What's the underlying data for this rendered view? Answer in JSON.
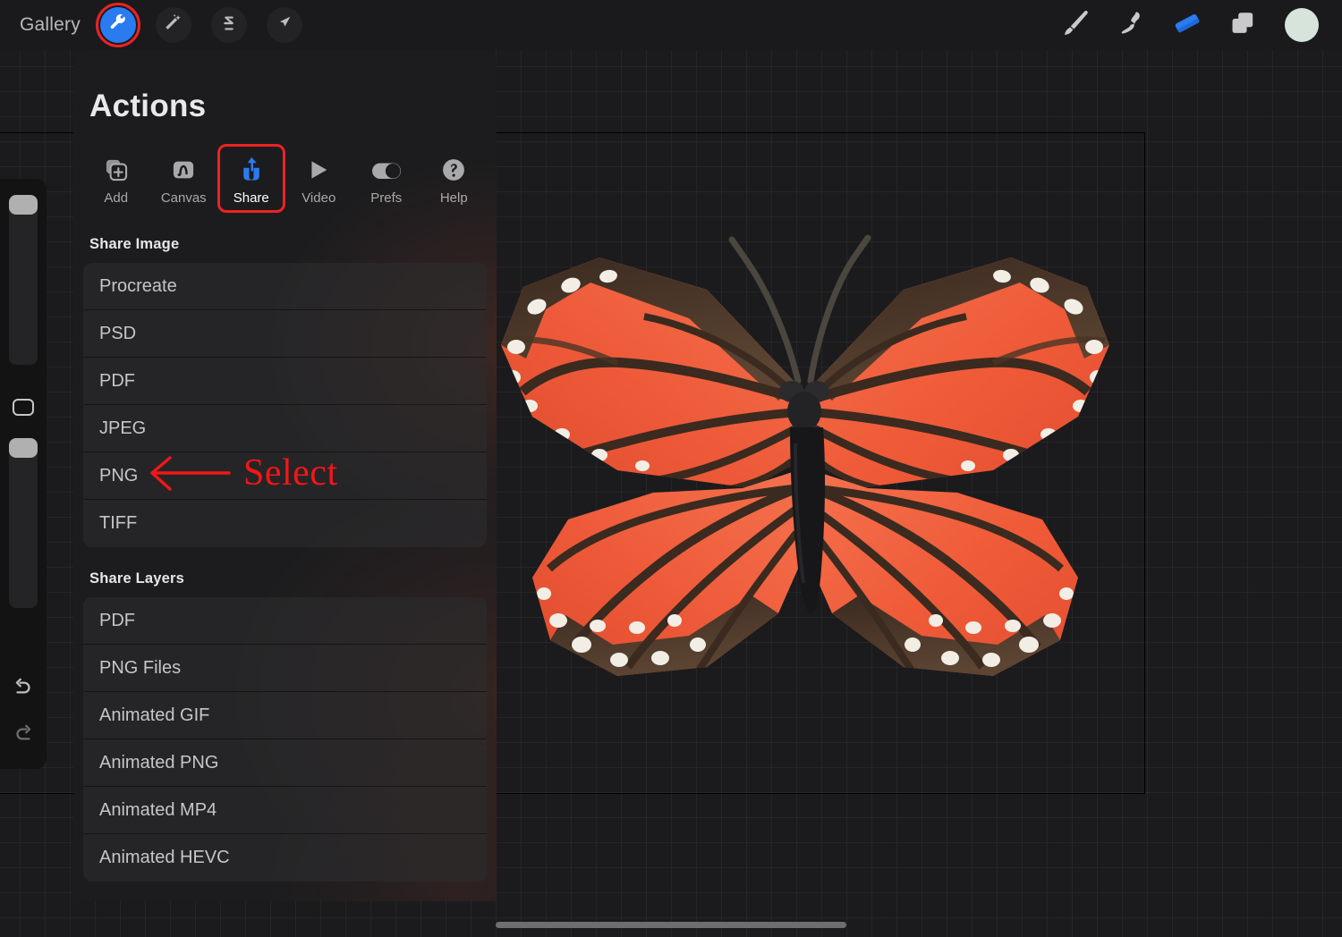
{
  "app": {
    "name": "Procreate",
    "accent_blue": "#2a7bf0",
    "highlight_red": "#ee2222",
    "annotation_red": "#f41616"
  },
  "topbar": {
    "gallery_label": "Gallery",
    "left_tools": [
      {
        "name": "actions-wrench",
        "icon": "wrench-icon",
        "active": true,
        "highlighted": true
      },
      {
        "name": "adjustments",
        "icon": "magic-wand-icon",
        "active": false,
        "highlighted": false
      },
      {
        "name": "selection",
        "icon": "s-curve-icon",
        "active": false,
        "highlighted": false
      },
      {
        "name": "transform",
        "icon": "arrow-diagonal-icon",
        "active": false,
        "highlighted": false
      }
    ],
    "right_tools": [
      {
        "name": "paint",
        "icon": "paintbrush-icon",
        "active": false
      },
      {
        "name": "smudge",
        "icon": "smudge-finger-icon",
        "active": false
      },
      {
        "name": "erase",
        "icon": "eraser-icon",
        "active": true
      },
      {
        "name": "layers",
        "icon": "layers-icon",
        "active": false
      }
    ],
    "color_swatch": "#d6e4dc"
  },
  "sidebar": {
    "brush_size_value": "100%",
    "brush_opacity_value": "100%",
    "modify_icon": "square-modify-icon",
    "undo_icon": "undo-arrow-icon",
    "redo_icon": "redo-arrow-icon"
  },
  "panel": {
    "title": "Actions",
    "tabs": [
      {
        "label": "Add",
        "icon": "add-stack-icon",
        "selected": false
      },
      {
        "label": "Canvas",
        "icon": "canvas-wave-icon",
        "selected": false
      },
      {
        "label": "Share",
        "icon": "share-arrow-icon",
        "selected": true
      },
      {
        "label": "Video",
        "icon": "play-icon",
        "selected": false
      },
      {
        "label": "Prefs",
        "icon": "toggle-icon",
        "selected": false
      },
      {
        "label": "Help",
        "icon": "question-icon",
        "selected": false
      }
    ],
    "share_image": {
      "heading": "Share Image",
      "items": [
        {
          "label": "Procreate"
        },
        {
          "label": "PSD"
        },
        {
          "label": "PDF"
        },
        {
          "label": "JPEG"
        },
        {
          "label": "PNG",
          "annotated": true
        },
        {
          "label": "TIFF"
        }
      ]
    },
    "share_layers": {
      "heading": "Share Layers",
      "items": [
        {
          "label": "PDF"
        },
        {
          "label": "PNG Files"
        },
        {
          "label": "Animated GIF"
        },
        {
          "label": "Animated PNG"
        },
        {
          "label": "Animated MP4"
        },
        {
          "label": "Animated HEVC"
        }
      ]
    }
  },
  "annotation": {
    "text": "Select",
    "icon": "left-arrow-icon",
    "points_to": "PNG"
  },
  "canvas": {
    "artwork_subject": "monarch-butterfly",
    "wing_color": "#ef5f3f",
    "wing_dark": "#4a3428",
    "spot_color": "#f2eee6"
  }
}
